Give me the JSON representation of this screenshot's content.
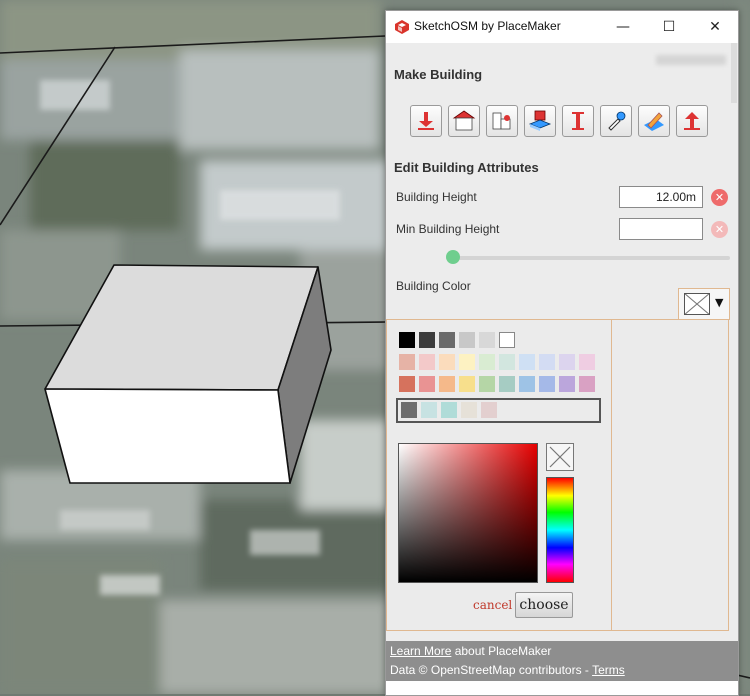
{
  "window": {
    "title": "SketchOSM by PlaceMaker",
    "controls": {
      "minimize": "—",
      "maximize": "☐",
      "close": "✕"
    }
  },
  "make_building": {
    "title": "Make Building",
    "tools": [
      {
        "icon": "import-down-arrow-icon"
      },
      {
        "icon": "house-icon"
      },
      {
        "icon": "building-parts-icon"
      },
      {
        "icon": "building-extrude-icon"
      },
      {
        "icon": "height-measure-icon"
      },
      {
        "icon": "eyedropper-icon"
      },
      {
        "icon": "paint-pencil-icon"
      },
      {
        "icon": "upload-up-arrow-icon"
      }
    ]
  },
  "edit_attributes": {
    "title": "Edit Building Attributes",
    "building_height": {
      "label": "Building Height",
      "value": "12.00m"
    },
    "min_building_height": {
      "label": "Min Building Height",
      "value": ""
    },
    "slider": {
      "value": 0
    },
    "building_color": {
      "label": "Building Color",
      "caret": "▼"
    }
  },
  "color_picker": {
    "swatch_rows": [
      [
        "#000000",
        "#3c3c3c",
        "#6a6a6a",
        "#c8c8c8",
        "#d8d8d8",
        "#ffffff"
      ],
      [
        "#e6b3a6",
        "#f3c9c9",
        "#fbdcbc",
        "#fdf2c2",
        "#d9ecd2",
        "#d2e6df",
        "#cfe0f4",
        "#d3dcf3",
        "#dcd4ee",
        "#efcde2"
      ],
      [
        "#d6725d",
        "#e99393",
        "#f5b98a",
        "#f7df8c",
        "#b5d6a6",
        "#a6ccc3",
        "#9ec3e6",
        "#a5b9e8",
        "#bba6dc",
        "#d9a1c3"
      ]
    ],
    "recent_swatches": [
      "#6e6e6e",
      "#c7e2e2",
      "#b0dcd8",
      "#e6e1d8",
      "#e3cfcf"
    ],
    "cancel_label": "cancel",
    "choose_label": "choose"
  },
  "footer": {
    "learn_more": "Learn More",
    "about": " about PlaceMaker",
    "data_credit": "Data © OpenStreetMap contributors - ",
    "terms": "Terms"
  },
  "colors": {
    "accent_red": "#e05050",
    "slider_green": "#6fce8e",
    "footer_gray": "#8e8e8e"
  }
}
